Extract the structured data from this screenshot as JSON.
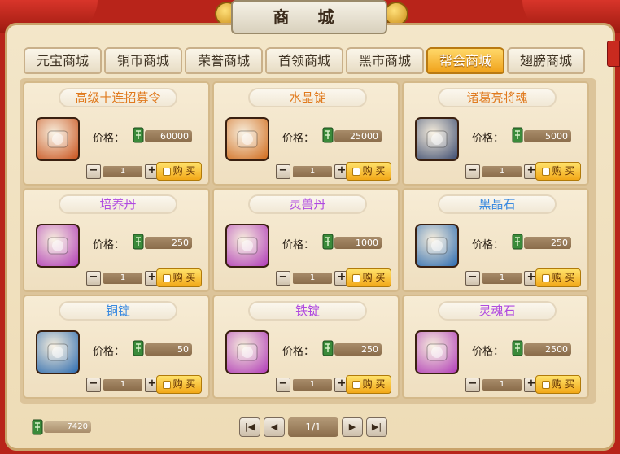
{
  "window": {
    "title": "商 城"
  },
  "tabs": [
    {
      "label": "元宝商城"
    },
    {
      "label": "铜币商城"
    },
    {
      "label": "荣誉商城"
    },
    {
      "label": "首领商城"
    },
    {
      "label": "黑市商城"
    },
    {
      "label": "帮会商城",
      "active": true
    },
    {
      "label": "翅膀商城"
    }
  ],
  "price_label": "价格：",
  "buy_label": "购 买",
  "items": [
    {
      "name": "高级十连招募令",
      "price": "60000",
      "qty": "1",
      "name_color": "#e07a1e",
      "icon": "recruit-token-icon",
      "icon_bg": "#c8501a"
    },
    {
      "name": "水晶锭",
      "price": "25000",
      "qty": "1",
      "name_color": "#e07a1e",
      "icon": "crystal-ingot-icon",
      "icon_bg": "#d06a1a"
    },
    {
      "name": "诸葛亮将魂",
      "price": "5000",
      "qty": "1",
      "name_color": "#e07a1e",
      "icon": "zhuge-liang-portrait-icon",
      "icon_bg": "#3a4a70"
    },
    {
      "name": "培养丹",
      "price": "250",
      "qty": "1",
      "name_color": "#b04ae0",
      "icon": "cultivation-pill-icon",
      "icon_bg": "#b03ab8"
    },
    {
      "name": "灵兽丹",
      "price": "1000",
      "qty": "1",
      "name_color": "#b04ae0",
      "icon": "beast-pill-icon",
      "icon_bg": "#b03ab8"
    },
    {
      "name": "黑晶石",
      "price": "250",
      "qty": "1",
      "name_color": "#3a8ae0",
      "icon": "black-crystal-icon",
      "icon_bg": "#2a6ab0"
    },
    {
      "name": "铜锭",
      "price": "50",
      "qty": "1",
      "name_color": "#3a8ae0",
      "icon": "copper-ingot-icon",
      "icon_bg": "#2a6ab0"
    },
    {
      "name": "铁锭",
      "price": "250",
      "qty": "1",
      "name_color": "#b04ae0",
      "icon": "iron-ingot-icon",
      "icon_bg": "#b03ab8"
    },
    {
      "name": "灵魂石",
      "price": "2500",
      "qty": "1",
      "name_color": "#b04ae0",
      "icon": "soul-stone-icon",
      "icon_bg": "#b03ab8"
    }
  ],
  "footer": {
    "balance": "7420",
    "page": "1/1"
  }
}
